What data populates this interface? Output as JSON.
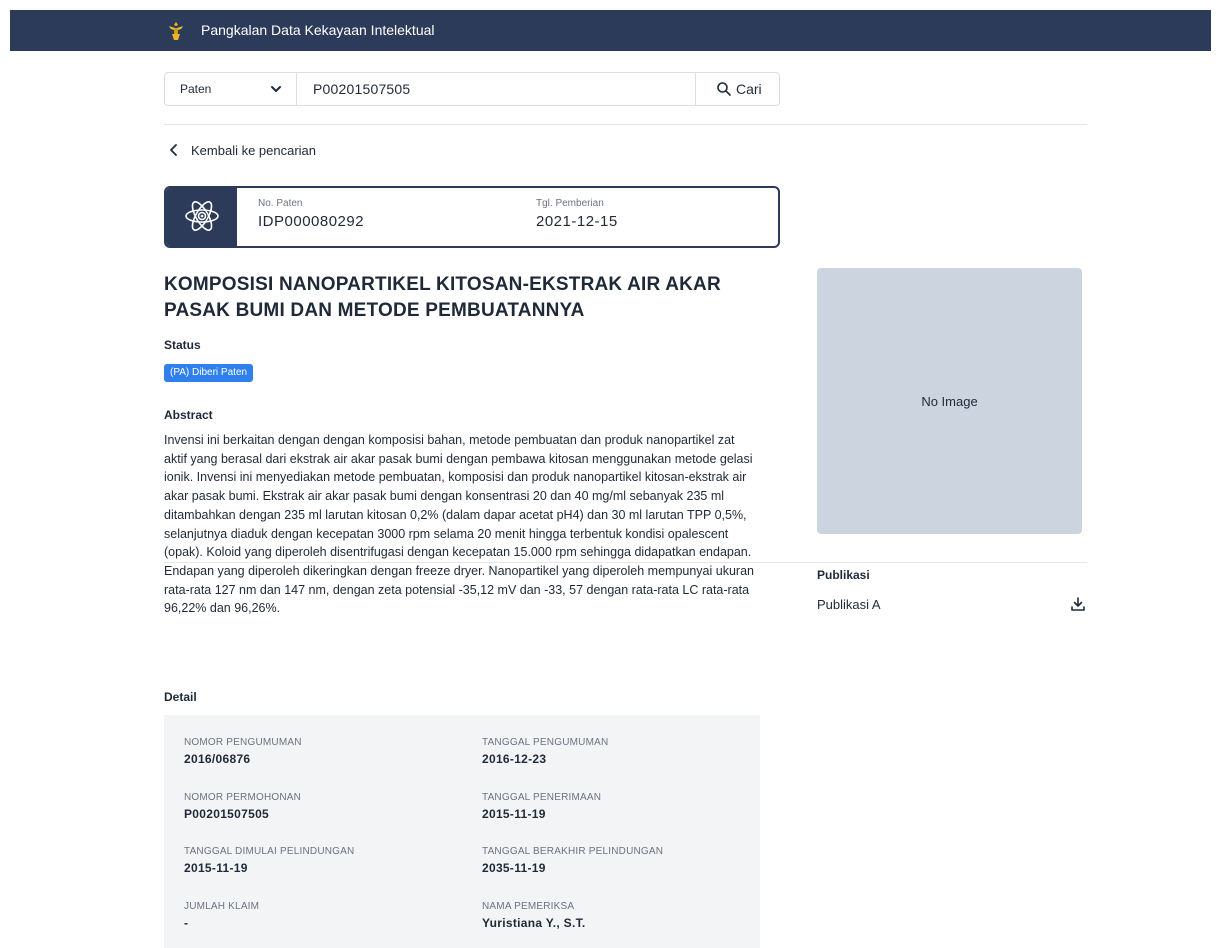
{
  "header": {
    "title": "Pangkalan Data Kekayaan Intelektual"
  },
  "search": {
    "type_selected": "Paten",
    "query": "P00201507505",
    "button_label": "Cari"
  },
  "back_link": {
    "label": "Kembali ke pencarian"
  },
  "patent_card": {
    "number_label": "No. Paten",
    "number_value": "IDP000080292",
    "grant_date_label": "Tgl. Pemberian",
    "grant_date_value": "2021-12-15"
  },
  "title": "KOMPOSISI NANOPARTIKEL KITOSAN-EKSTRAK AIR AKAR PASAK BUMI DAN METODE PEMBUATANNYA",
  "status": {
    "label": "Status",
    "badge": "(PA) Diberi Paten",
    "badge_color": "#2f80ed"
  },
  "abstract": {
    "label": "Abstract",
    "text": "Invensi ini berkaitan dengan dengan komposisi bahan, metode pembuatan dan produk nanopartikel zat aktif yang berasal dari ekstrak air akar pasak bumi dengan pembawa kitosan menggunakan metode gelasi ionik. Invensi ini menyediakan metode pembuatan, komposisi dan produk nanopartikel kitosan-ekstrak air akar pasak bumi. Ekstrak air akar pasak bumi dengan konsentrasi 20 dan 40 mg/ml sebanyak 235 ml ditambahkan dengan 235 ml larutan kitosan 0,2% (dalam dapar acetat pH4) dan 30 ml larutan TPP 0,5%, selanjutnya diaduk dengan kecepatan 3000 rpm selama 20 menit hingga terbentuk kondisi opalescent (opak). Koloid yang diperoleh disentrifugasi dengan kecepatan 15.000 rpm sehingga didapatkan endapan. Endapan yang diperoleh dikeringkan dengan freeze dryer. Nanopartikel yang diperoleh mempunyai ukuran rata-rata 127 nm dan 147 nm, dengan zeta potensial -35,12 mV dan -33, 57 dengan rata-rata LC rata-rata 96,22% dan 96,26%."
  },
  "image_placeholder": "No Image",
  "publikasi": {
    "label": "Publikasi",
    "item": "Publikasi A"
  },
  "detail": {
    "label": "Detail",
    "fields": [
      {
        "label": "NOMOR PENGUMUMAN",
        "value": "2016/06876"
      },
      {
        "label": "TANGGAL PENGUMUMAN",
        "value": "2016-12-23"
      },
      {
        "label": "NOMOR PERMOHONAN",
        "value": "P00201507505"
      },
      {
        "label": "TANGGAL PENERIMAAN",
        "value": "2015-11-19"
      },
      {
        "label": "TANGGAL DIMULAI PELINDUNGAN",
        "value": "2015-11-19"
      },
      {
        "label": "TANGGAL BERAKHIR PELINDUNGAN",
        "value": "2035-11-19"
      },
      {
        "label": "JUMLAH KLAIM",
        "value": "-"
      },
      {
        "label": "NAMA PEMERIKSA",
        "value": "Yuristiana Y., S.T."
      }
    ]
  },
  "colors": {
    "navy": "#2d3b5a",
    "placeholder_bg": "#ccd5df",
    "detail_bg": "#f3f4f6"
  }
}
